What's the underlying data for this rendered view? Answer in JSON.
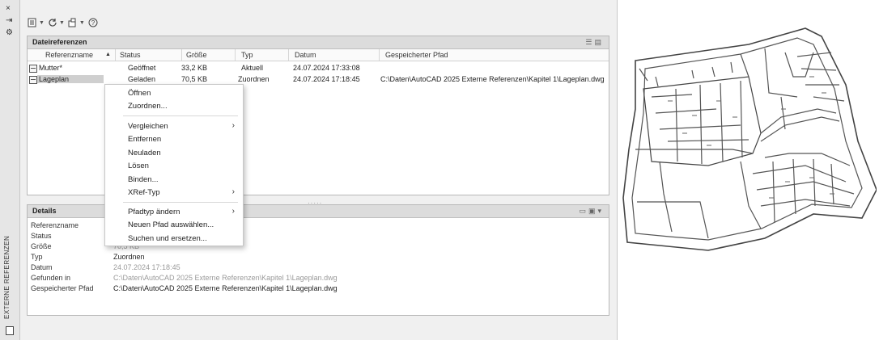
{
  "side": {
    "close": "×",
    "autohide": "⇥",
    "settings": "⚙",
    "title": "EXTERNE REFERENZEN"
  },
  "toolbar": {
    "attach_icon": "attach-dwg-icon",
    "refresh_icon": "refresh-icon",
    "change_path_icon": "change-path-icon",
    "help_icon": "help-icon"
  },
  "file_refs": {
    "title": "Dateireferenzen",
    "columns": [
      "Referenzname",
      "Status",
      "Größe",
      "Typ",
      "Datum",
      "Gespeicherter Pfad"
    ],
    "sort_indicator": "▲",
    "rows": [
      {
        "name": "Mutter*",
        "status": "Geöffnet",
        "size": "33,2 KB",
        "type": "Aktuell",
        "date": "24.07.2024 17:33:08",
        "path": ""
      },
      {
        "name": "Lageplan",
        "status": "Geladen",
        "size": "70,5 KB",
        "type": "Zuordnen",
        "date": "24.07.2024 17:18:45",
        "path": "C:\\Daten\\AutoCAD 2025 Externe Referenzen\\Kapitel 1\\Lageplan.dwg"
      }
    ]
  },
  "splitter": "·····",
  "details": {
    "title": "Details",
    "rows": [
      {
        "key": "Referenzname",
        "value": ""
      },
      {
        "key": "Status",
        "value": ""
      },
      {
        "key": "Größe",
        "value": "70,5 KB"
      },
      {
        "key": "Typ",
        "value": "Zuordnen"
      },
      {
        "key": "Datum",
        "value": "24.07.2024 17:18:45"
      },
      {
        "key": "Gefunden in",
        "value": "C:\\Daten\\AutoCAD 2025 Externe Referenzen\\Kapitel 1\\Lageplan.dwg"
      },
      {
        "key": "Gespeicherter Pfad",
        "value": "C:\\Daten\\AutoCAD 2025 Externe Referenzen\\Kapitel 1\\Lageplan.dwg"
      }
    ]
  },
  "context_menu": {
    "items": [
      {
        "label": "Öffnen",
        "submenu": false
      },
      {
        "label": "Zuordnen...",
        "submenu": false
      },
      {
        "label": "Vergleichen",
        "submenu": true
      },
      {
        "label": "Entfernen",
        "submenu": false
      },
      {
        "label": "Neuladen",
        "submenu": false
      },
      {
        "label": "Lösen",
        "submenu": false
      },
      {
        "label": "Binden...",
        "submenu": false
      },
      {
        "label": "XRef-Typ",
        "submenu": true
      },
      {
        "label": "Pfadtyp ändern",
        "submenu": true
      },
      {
        "label": "Neuen Pfad auswählen...",
        "submenu": false
      },
      {
        "label": "Suchen und ersetzen...",
        "submenu": false
      }
    ],
    "submenu_glyph": "›"
  },
  "colors": {
    "palette_bg": "#f0f0f0",
    "header_bg": "#dcdcdc",
    "selection": "#cfcfcf"
  }
}
